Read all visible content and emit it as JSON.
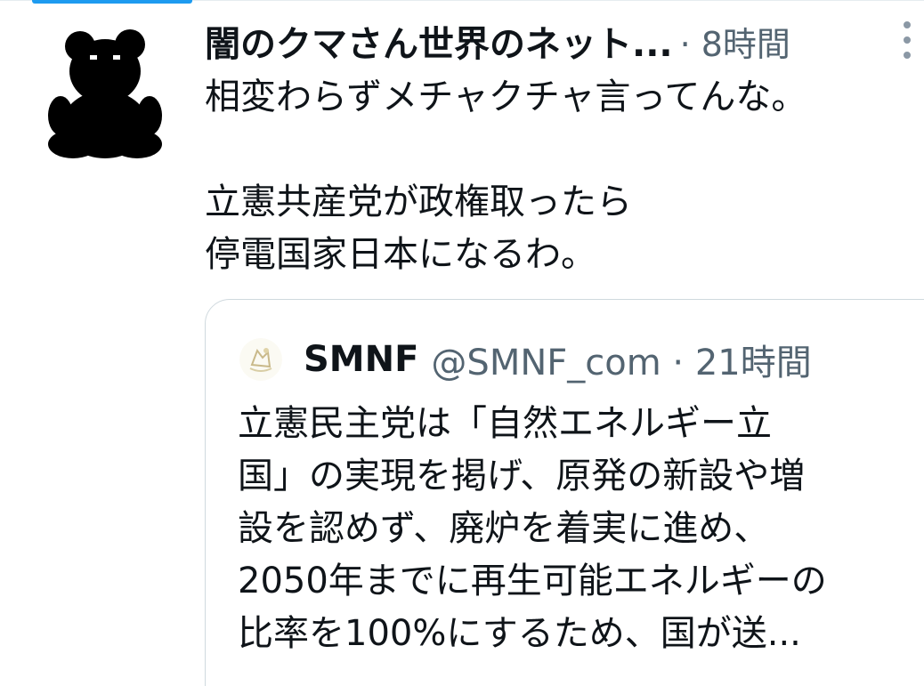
{
  "tweet": {
    "display_name": "闇のクマさん世界のネット...",
    "meta": "· 8時間",
    "text_line1": "相変わらずメチャクチャ言ってんな。",
    "text_line2": "立憲共産党が政権取ったら",
    "text_line3": "停電国家日本になるわ。"
  },
  "quote": {
    "display_name": "SMNF",
    "handle_time": "@SMNF_com · 21時間",
    "text_line1": "立憲民主党は「自然エネルギー立",
    "text_line2": "国」の実現を掲げ、原発の新設や増",
    "text_line3": "設を認めず、廃炉を着実に進め、",
    "text_line4": "2050年までに再生可能エネルギーの",
    "text_line5": "比率を100%にするため、国が送..."
  },
  "icons": {
    "avatar": "bear-silhouette-avatar",
    "more": "more-vertical-icon",
    "quote_avatar": "smnf-logo-avatar"
  },
  "colors": {
    "text": "#0f1419",
    "secondary": "#536471",
    "border": "#cfd9de",
    "accent": "#1d9bf0"
  }
}
